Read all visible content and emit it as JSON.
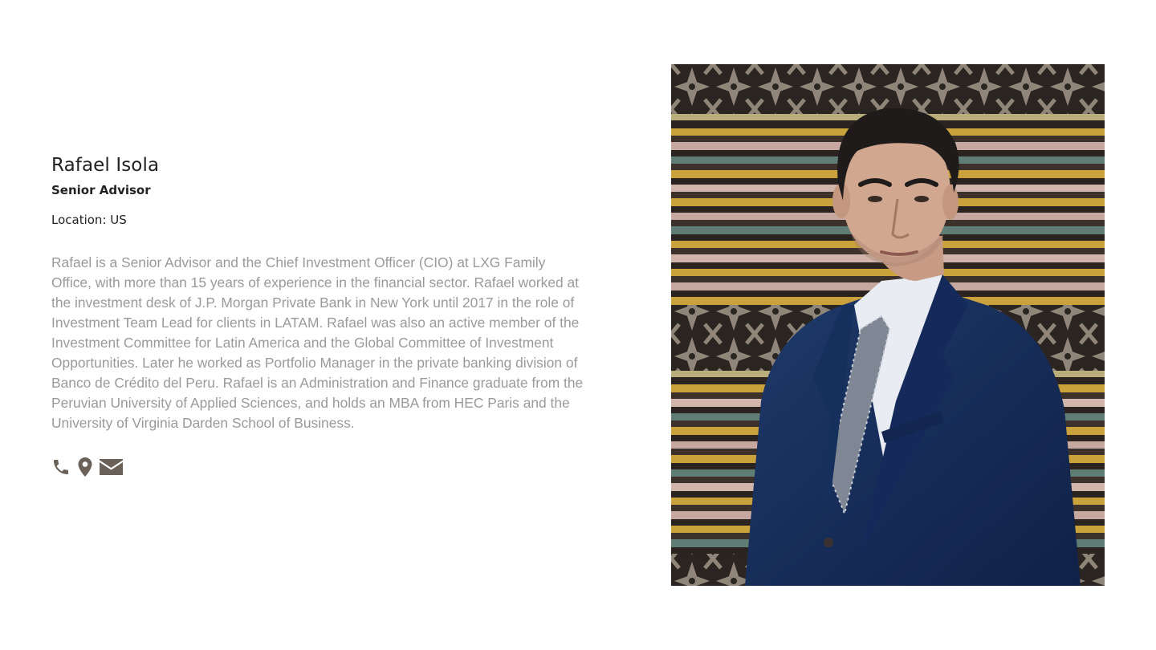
{
  "profile": {
    "name": "Rafael Isola",
    "title": "Senior Advisor",
    "location": "Location: US",
    "bio": "Rafael is a Senior Advisor and the Chief Investment Officer (CIO) at LXG Family Office, with more than 15 years of experience in the financial sector. Rafael worked at the investment desk of J.P. Morgan Private Bank in New York until 2017 in the role of Investment Team Lead for clients in LATAM. Rafael was also an active member of the Investment Committee for Latin America and the Global Committee of Investment Opportunities. Later he worked as Portfolio Manager in the private banking division of Banco de Crédito del Peru. Rafael is an Administration and Finance graduate from the Peruvian University of Applied Sciences, and holds an MBA from HEC Paris and the University of Virginia Darden School of Business."
  },
  "contact": {
    "icons": [
      "phone-icon",
      "location-pin-icon",
      "email-icon"
    ],
    "icon_color": "#6b6158"
  },
  "photo": {
    "subject": "portrait"
  },
  "colors": {
    "heading": "#222222",
    "body_text": "#9a9a9a",
    "background": "#ffffff"
  }
}
